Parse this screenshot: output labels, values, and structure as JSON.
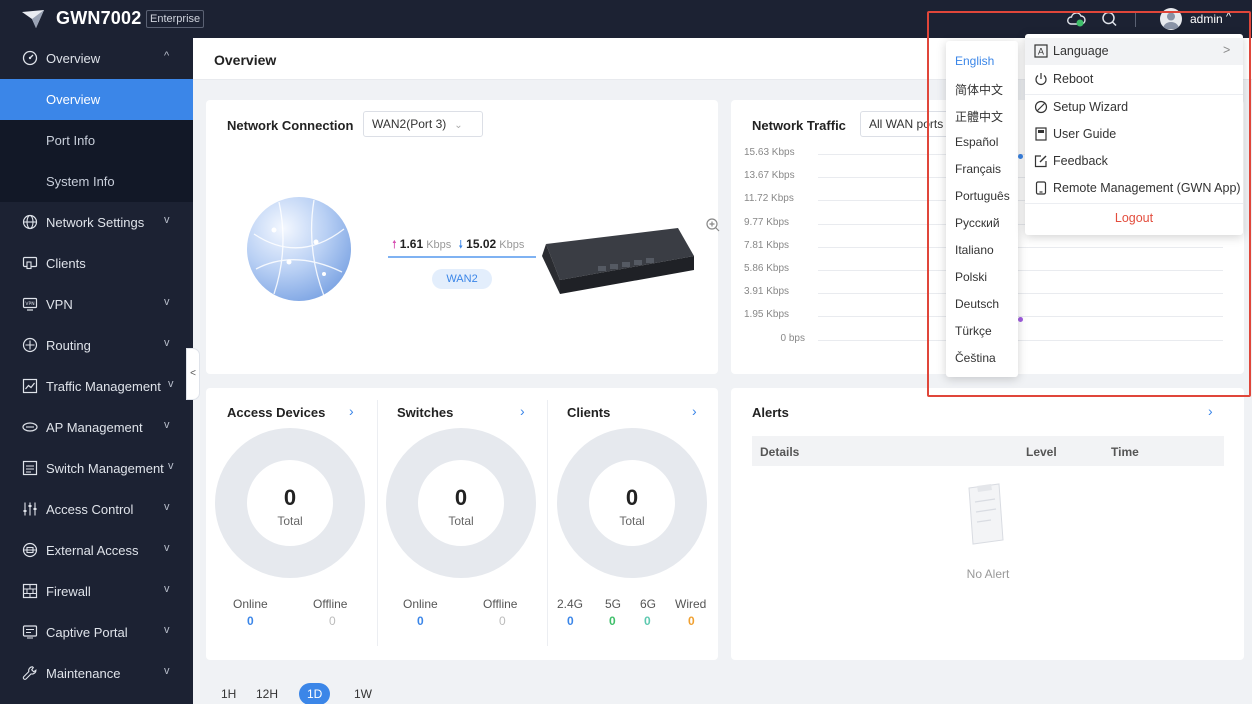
{
  "header": {
    "brand": "GWN7002",
    "edition": "Enterprise",
    "user": "admin",
    "icons": [
      "logo-icon",
      "cloud-icon",
      "search-icon",
      "user-avatar-icon",
      "chevron-up-icon"
    ]
  },
  "sidebar": {
    "items": [
      {
        "label": "Overview",
        "icon": "overview-icon",
        "chevron": "^"
      },
      {
        "label": "Network Settings",
        "icon": "globe-icon",
        "chevron": "v"
      },
      {
        "label": "Clients",
        "icon": "clients-icon",
        "chevron": ""
      },
      {
        "label": "VPN",
        "icon": "vpn-icon",
        "chevron": "v"
      },
      {
        "label": "Routing",
        "icon": "routing-icon",
        "chevron": "v"
      },
      {
        "label": "Traffic Management",
        "icon": "traffic-icon",
        "chevron": "v"
      },
      {
        "label": "AP Management",
        "icon": "ap-icon",
        "chevron": "v"
      },
      {
        "label": "Switch Management",
        "icon": "switch-icon",
        "chevron": "v"
      },
      {
        "label": "Access Control",
        "icon": "access-control-icon",
        "chevron": "v"
      },
      {
        "label": "External Access",
        "icon": "external-access-icon",
        "chevron": "v"
      },
      {
        "label": "Firewall",
        "icon": "firewall-icon",
        "chevron": "v"
      },
      {
        "label": "Captive Portal",
        "icon": "captive-portal-icon",
        "chevron": "v"
      },
      {
        "label": "Maintenance",
        "icon": "maintenance-icon",
        "chevron": "v"
      }
    ],
    "subitems": [
      {
        "label": "Overview",
        "active": true
      },
      {
        "label": "Port Info",
        "active": false
      },
      {
        "label": "System Info",
        "active": false
      }
    ],
    "collapse_glyph": "<"
  },
  "page": {
    "title": "Overview"
  },
  "network_connection": {
    "title": "Network Connection",
    "select": "WAN2(Port 3)",
    "up_value": "1.61",
    "up_unit": "Kbps",
    "down_value": "15.02",
    "down_unit": "Kbps",
    "wan_tag": "WAN2"
  },
  "network_traffic": {
    "title": "Network Traffic",
    "select": "All WAN ports",
    "y_labels": [
      "15.63 Kbps",
      "13.67 Kbps",
      "11.72 Kbps",
      "9.77 Kbps",
      "7.81 Kbps",
      "5.86 Kbps",
      "3.91 Kbps",
      "1.95 Kbps",
      "0 bps"
    ]
  },
  "access_devices": {
    "title": "Access Devices",
    "total": "0",
    "total_label": "Total",
    "stats": [
      {
        "label": "Online",
        "value": "0"
      },
      {
        "label": "Offline",
        "value": "0"
      }
    ]
  },
  "switches": {
    "title": "Switches",
    "total": "0",
    "total_label": "Total",
    "stats": [
      {
        "label": "Online",
        "value": "0"
      },
      {
        "label": "Offline",
        "value": "0"
      }
    ]
  },
  "clients": {
    "title": "Clients",
    "total": "0",
    "total_label": "Total",
    "stats": [
      {
        "label": "2.4G",
        "value": "0"
      },
      {
        "label": "5G",
        "value": "0"
      },
      {
        "label": "6G",
        "value": "0"
      },
      {
        "label": "Wired",
        "value": "0"
      }
    ]
  },
  "alerts": {
    "title": "Alerts",
    "columns": [
      "Details",
      "Level",
      "Time"
    ],
    "empty": "No Alert"
  },
  "time_range": [
    "1H",
    "12H",
    "1D",
    "1W"
  ],
  "language_menu": [
    "English",
    "简体中文",
    "正體中文",
    "Español",
    "Français",
    "Português",
    "Русский",
    "Italiano",
    "Polski",
    "Deutsch",
    "Türkçe",
    "Čeština"
  ],
  "user_menu": {
    "items": [
      {
        "label": "Language",
        "icon": "language-icon",
        "arrow": ">"
      },
      {
        "label": "Reboot",
        "icon": "power-icon"
      },
      {
        "label": "Setup Wizard",
        "icon": "wizard-icon"
      },
      {
        "label": "User Guide",
        "icon": "book-icon"
      },
      {
        "label": "Feedback",
        "icon": "feedback-icon"
      },
      {
        "label": "Remote Management (GWN App)",
        "icon": "mobile-icon"
      }
    ],
    "logout": "Logout"
  },
  "colors": {
    "sidebar_bg": "#1c2233",
    "accent": "#3b86e8",
    "highlight": "#e0463a",
    "logout": "#e34d3d",
    "green": "#3fbf6a",
    "orange": "#f0a030"
  }
}
